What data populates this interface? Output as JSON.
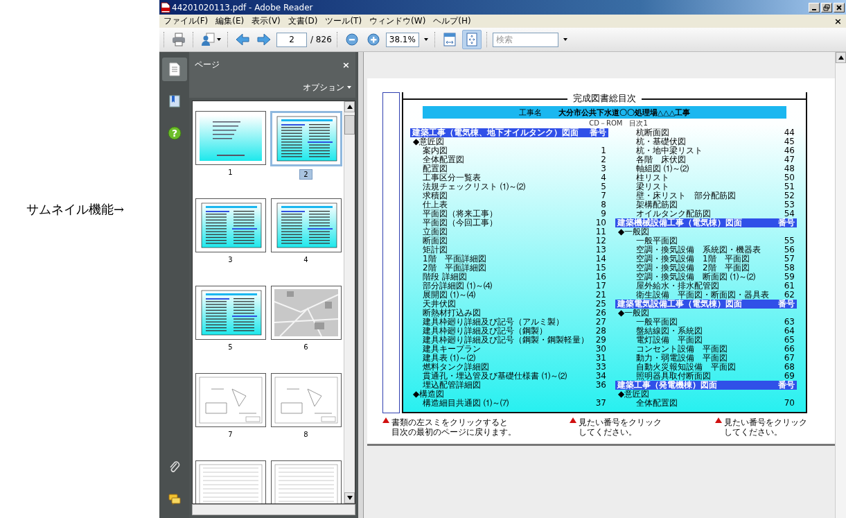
{
  "annotation": "サムネイル機能→",
  "window": {
    "title": "44201020113.pdf - Adobe Reader"
  },
  "menu": [
    "ファイル(F)",
    "編集(E)",
    "表示(V)",
    "文書(D)",
    "ツール(T)",
    "ウィンドウ(W)",
    "ヘルプ(H)"
  ],
  "menu_close": "×",
  "toolbar": {
    "page_field": "2",
    "page_total": "/ 826",
    "zoom_field": "38.1%",
    "fit_page_selected": true,
    "search": {
      "placeholder": "検索"
    }
  },
  "side_tools": [
    {
      "kind": "pages",
      "selected": true
    },
    {
      "kind": "bookmarks",
      "selected": false
    },
    {
      "kind": "help",
      "selected": false,
      "glyph": "?"
    },
    {
      "kind": "attachments",
      "selected": false
    },
    {
      "kind": "comments",
      "selected": false
    }
  ],
  "panel": {
    "title": "ページ",
    "close": "×",
    "options": "オプション"
  },
  "thumbnails": [
    {
      "label": "1",
      "kind": "cover",
      "selected": false
    },
    {
      "label": "2",
      "kind": "toc",
      "selected": true
    },
    {
      "label": "3",
      "kind": "toc",
      "selected": false
    },
    {
      "label": "4",
      "kind": "toc",
      "selected": false
    },
    {
      "label": "5",
      "kind": "toc",
      "selected": false
    },
    {
      "label": "6",
      "kind": "map",
      "selected": false
    },
    {
      "label": "7",
      "kind": "drawing",
      "selected": false
    },
    {
      "label": "8",
      "kind": "drawing",
      "selected": false
    },
    {
      "kind": "table",
      "selected": false
    },
    {
      "kind": "table",
      "selected": false
    }
  ],
  "document": {
    "title": "完成図書総目次",
    "project_label": "工事名",
    "project_name": "大分市公共下水道〇〇処理場△△△工事",
    "cd_line": "CD－ROM　目次1",
    "columns": [
      [
        {
          "kind": "header",
          "label": "建築工事（電気棟、地下オイルタンク）図面",
          "number": "番号"
        },
        {
          "kind": "category",
          "label": "◆意匠図"
        },
        {
          "kind": "item",
          "label": "案内図",
          "number": "1"
        },
        {
          "kind": "item",
          "label": "全体配置図",
          "number": "2"
        },
        {
          "kind": "item",
          "label": "配置図",
          "number": "3"
        },
        {
          "kind": "item",
          "label": "工事区分一覧表",
          "number": "4"
        },
        {
          "kind": "item",
          "label": "法規チェックリスト ⑴～⑵",
          "number": "5"
        },
        {
          "kind": "item",
          "label": "求積図",
          "number": "7"
        },
        {
          "kind": "item",
          "label": "仕上表",
          "number": "8"
        },
        {
          "kind": "item",
          "label": "平面図（将来工事）",
          "number": "9"
        },
        {
          "kind": "item",
          "label": "平面図（今回工事）",
          "number": "10"
        },
        {
          "kind": "item",
          "label": "立面図",
          "number": "11"
        },
        {
          "kind": "item",
          "label": "断面図",
          "number": "12"
        },
        {
          "kind": "item",
          "label": "矩計図",
          "number": "13"
        },
        {
          "kind": "item",
          "label": "1階　平面詳細図",
          "number": "14"
        },
        {
          "kind": "item",
          "label": "2階　平面詳細図",
          "number": "15"
        },
        {
          "kind": "item",
          "label": "階段 詳細図",
          "number": "16"
        },
        {
          "kind": "item",
          "label": "部分詳細図 ⑴～⑷",
          "number": "17"
        },
        {
          "kind": "item",
          "label": "展開図 ⑴～⑷",
          "number": "21"
        },
        {
          "kind": "item",
          "label": "天井伏図",
          "number": "25"
        },
        {
          "kind": "item",
          "label": "断熱材打込み図",
          "number": "26"
        },
        {
          "kind": "item",
          "label": "建具枠廻り詳細及び記号（アルミ製）",
          "number": "27"
        },
        {
          "kind": "item",
          "label": "建具枠廻り詳細及び記号（鋼製）",
          "number": "28"
        },
        {
          "kind": "item",
          "label": "建具枠廻り詳細及び記号（鋼製・鋼製軽量）",
          "number": "29"
        },
        {
          "kind": "item",
          "label": "建具キープラン",
          "number": "30"
        },
        {
          "kind": "item",
          "label": "建具表 ⑴～⑵",
          "number": "31"
        },
        {
          "kind": "item",
          "label": "燃料タンク詳細図",
          "number": "33"
        },
        {
          "kind": "item",
          "label": "貫通孔・埋込管及び基礎仕様書 ⑴～⑵",
          "number": "34"
        },
        {
          "kind": "item",
          "label": "埋込配管詳細図",
          "number": "36"
        },
        {
          "kind": "category",
          "label": "◆構造図"
        },
        {
          "kind": "item",
          "label": "構造細目共通図 ⑴～⑺",
          "number": "37"
        }
      ],
      [
        {
          "kind": "item",
          "label": "杭断面図",
          "number": "44"
        },
        {
          "kind": "item",
          "label": "杭・基礎伏図",
          "number": "45"
        },
        {
          "kind": "item",
          "label": "杭・地中梁リスト",
          "number": "46"
        },
        {
          "kind": "item",
          "label": "各階　床伏図",
          "number": "47"
        },
        {
          "kind": "item",
          "label": "軸組図 ⑴～⑵",
          "number": "48"
        },
        {
          "kind": "item",
          "label": "柱リスト",
          "number": "50"
        },
        {
          "kind": "item",
          "label": "梁リスト",
          "number": "51"
        },
        {
          "kind": "item",
          "label": "壁・床リスト　部分配筋図",
          "number": "52"
        },
        {
          "kind": "item",
          "label": "架構配筋図",
          "number": "53"
        },
        {
          "kind": "item",
          "label": "オイルタンク配筋図",
          "number": "54"
        },
        {
          "kind": "header",
          "label": "建築機械設備工事（電気棟）図面",
          "number": "番号"
        },
        {
          "kind": "category",
          "label": "◆一般図"
        },
        {
          "kind": "item",
          "label": "一般平面図",
          "number": "55"
        },
        {
          "kind": "item",
          "label": "空調・換気設備　系統図・機器表",
          "number": "56"
        },
        {
          "kind": "item",
          "label": "空調・換気設備　1階　平面図",
          "number": "57"
        },
        {
          "kind": "item",
          "label": "空調・換気設備　2階　平面図",
          "number": "58"
        },
        {
          "kind": "item",
          "label": "空調・換気設備　断面図 ⑴～⑵",
          "number": "59"
        },
        {
          "kind": "item",
          "label": "屋外給水・排水配管図",
          "number": "61"
        },
        {
          "kind": "item",
          "label": "衛生設備　平面図・断面図・器具表",
          "number": "62"
        },
        {
          "kind": "header",
          "label": "建築電気設備工事（電気棟）図面",
          "number": "番号"
        },
        {
          "kind": "category",
          "label": "◆一般図"
        },
        {
          "kind": "item",
          "label": "一般平面図",
          "number": "63"
        },
        {
          "kind": "item",
          "label": "盤結線図・系統図",
          "number": "64"
        },
        {
          "kind": "item",
          "label": "電灯設備　平面図",
          "number": "65"
        },
        {
          "kind": "item",
          "label": "コンセント設備　平面図",
          "number": "66"
        },
        {
          "kind": "item",
          "label": "動力・弱電設備　平面図",
          "number": "67"
        },
        {
          "kind": "item",
          "label": "自動火災報知設備　平面図",
          "number": "68"
        },
        {
          "kind": "item",
          "label": "照明器具取付断面図",
          "number": "69"
        },
        {
          "kind": "header",
          "label": "建築工事（発電機棟）図面",
          "number": "番号"
        },
        {
          "kind": "category",
          "label": "◆意匠図"
        },
        {
          "kind": "item",
          "label": "全体配置図",
          "number": "70"
        }
      ]
    ],
    "notes": [
      {
        "lines": [
          "書類の左スミをクリックすると",
          "目次の最初のページに戻ります。"
        ]
      },
      {
        "lines": [
          "見たい番号をクリック",
          "してください。"
        ]
      },
      {
        "lines": [
          "見たい番号をクリック",
          "してください。"
        ]
      }
    ]
  }
}
